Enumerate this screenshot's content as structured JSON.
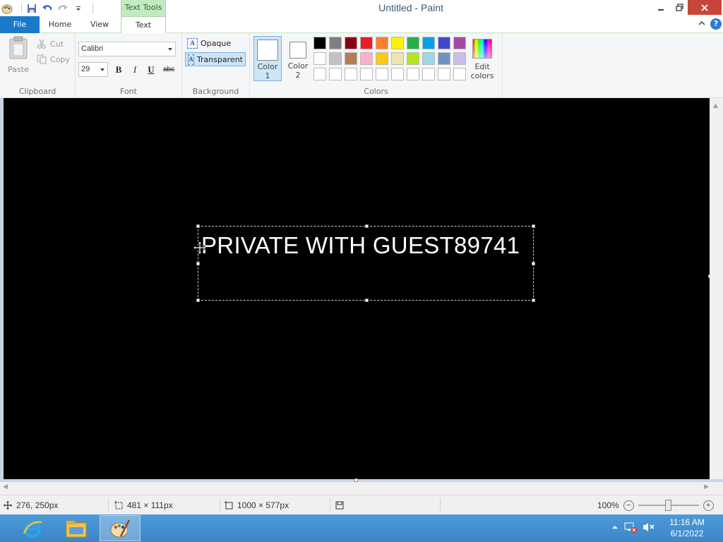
{
  "window": {
    "title": "Untitled - Paint",
    "contextual_group": "Text Tools"
  },
  "tabs": {
    "file": "File",
    "home": "Home",
    "view": "View",
    "text": "Text",
    "active": "Text"
  },
  "clipboard": {
    "paste": "Paste",
    "cut": "Cut",
    "copy": "Copy",
    "group_label": "Clipboard"
  },
  "font": {
    "family": "Calibri",
    "size": "29",
    "bold": "B",
    "italic": "I",
    "underline": "U",
    "strikethrough": "abc",
    "group_label": "Font"
  },
  "background": {
    "opaque": "Opaque",
    "transparent": "Transparent",
    "selected": "Transparent",
    "group_label": "Background"
  },
  "colors": {
    "color1_label": "Color",
    "color1_num": "1",
    "color2_label": "Color",
    "color2_num": "2",
    "color1_value": "#ffffff",
    "color2_value": "#ffffff",
    "edit_label_1": "Edit",
    "edit_label_2": "colors",
    "group_label": "Colors",
    "palette": [
      "#000000",
      "#7f7f7f",
      "#880015",
      "#ed1c24",
      "#ff7f27",
      "#fff200",
      "#22b14c",
      "#00a2e8",
      "#3f48cc",
      "#a349a4",
      "#ffffff",
      "#c3c3c3",
      "#b97a57",
      "#ffaec9",
      "#ffc90e",
      "#efe4b0",
      "#b5e61d",
      "#99d9ea",
      "#7092be",
      "#c8bfe7",
      "#ffffff",
      "#ffffff",
      "#ffffff",
      "#ffffff",
      "#ffffff",
      "#ffffff",
      "#ffffff",
      "#ffffff",
      "#ffffff",
      "#ffffff"
    ]
  },
  "canvas": {
    "background": "#000000",
    "text": "PRIVATE WITH GUEST89741",
    "text_color": "#ffffff"
  },
  "status": {
    "cursor_pos": "276, 250px",
    "selection_size": "481 × 111px",
    "image_size": "1000 × 577px",
    "zoom": "100%",
    "zoom_level": 1.0
  },
  "taskbar": {
    "apps": [
      "internet-explorer-icon",
      "file-explorer-icon",
      "paint-icon"
    ],
    "active_app": "paint-icon",
    "time": "11:16 AM",
    "date": "6/1/2022"
  }
}
